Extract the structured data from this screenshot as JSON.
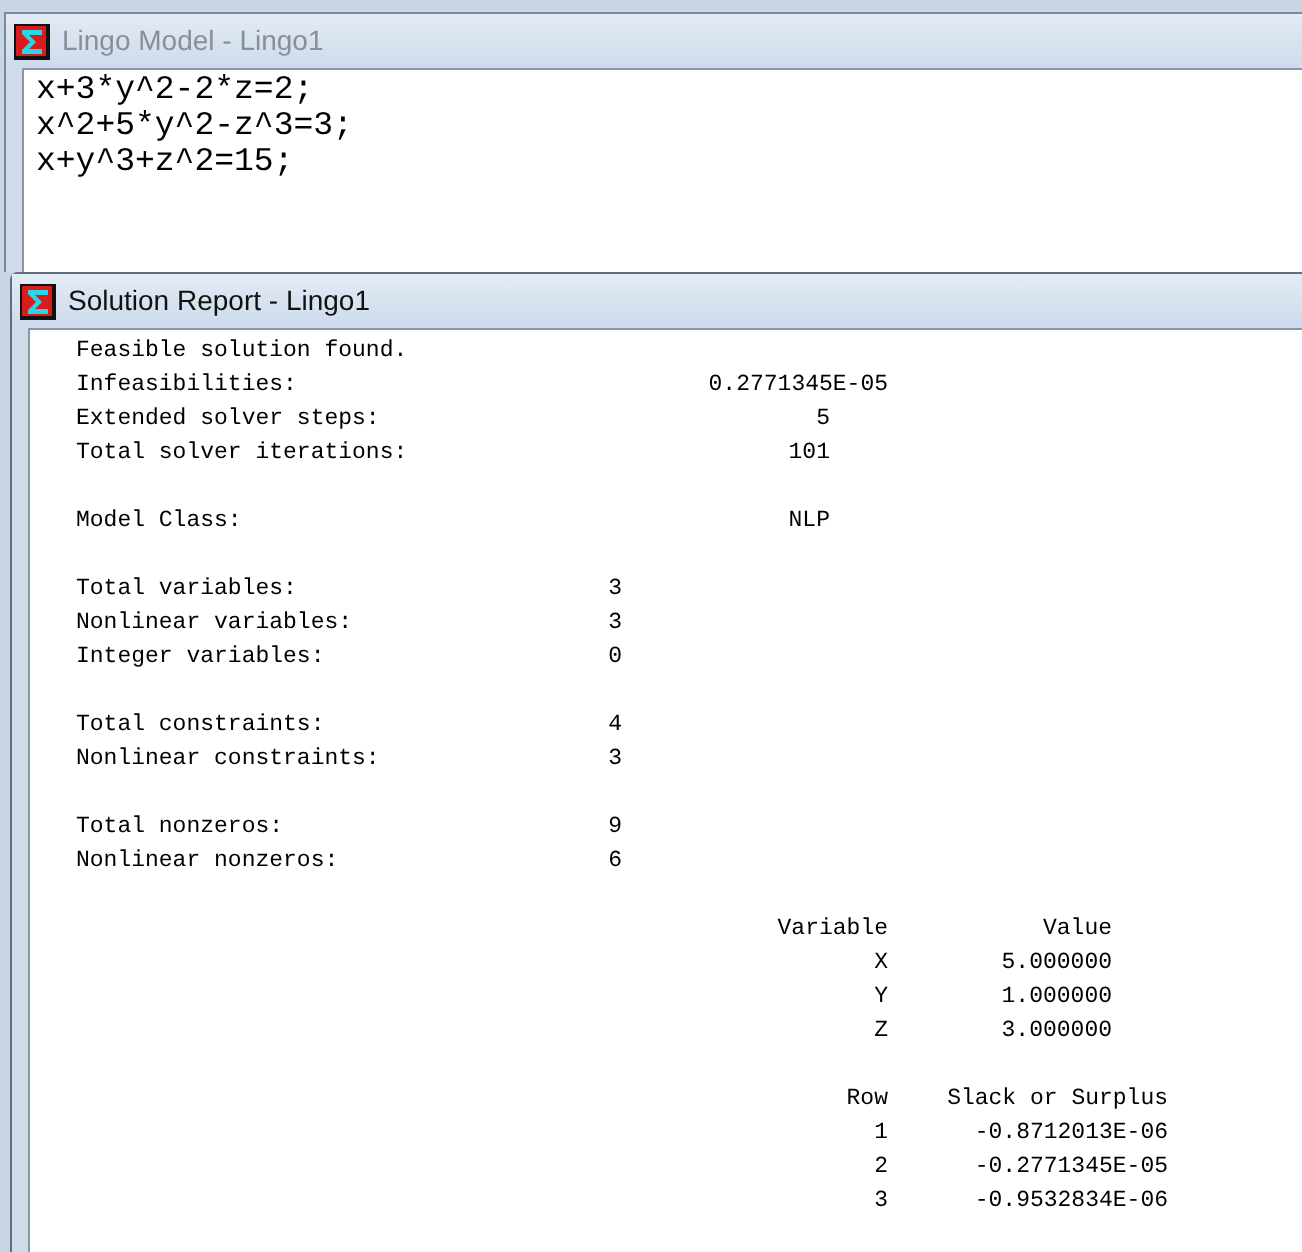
{
  "model_window": {
    "title": "Lingo Model - Lingo1",
    "active": false,
    "lines": [
      "x+3*y^2-2*z=2;",
      "x^2+5*y^2-z^3=3;",
      "x+y^3+z^2=15;"
    ]
  },
  "report_window": {
    "title": "Solution Report - Lingo1",
    "active": true,
    "status": "Feasible solution found.",
    "sections": [
      {
        "items": [
          {
            "label": "Infeasibilities:",
            "value": "0.2771345E-05",
            "kind": "wide"
          },
          {
            "label": "Extended solver steps:",
            "value": "5",
            "kind": "solver"
          },
          {
            "label": "Total solver iterations:",
            "value": "101",
            "kind": "solver"
          }
        ]
      },
      {
        "items": [
          {
            "label": "Model Class:",
            "value": "NLP",
            "kind": "solver"
          }
        ]
      },
      {
        "items": [
          {
            "label": "Total variables:",
            "value": "3",
            "kind": "count"
          },
          {
            "label": "Nonlinear variables:",
            "value": "3",
            "kind": "count"
          },
          {
            "label": "Integer variables:",
            "value": "0",
            "kind": "count"
          }
        ]
      },
      {
        "items": [
          {
            "label": "Total constraints:",
            "value": "4",
            "kind": "count"
          },
          {
            "label": "Nonlinear constraints:",
            "value": "3",
            "kind": "count"
          }
        ]
      },
      {
        "items": [
          {
            "label": "Total nonzeros:",
            "value": "9",
            "kind": "count"
          },
          {
            "label": "Nonlinear nonzeros:",
            "value": "6",
            "kind": "count"
          }
        ]
      }
    ],
    "tables": [
      {
        "kind": "variables",
        "headers": [
          "Variable",
          "Value"
        ],
        "rows": [
          [
            "X",
            "5.000000"
          ],
          [
            "Y",
            "1.000000"
          ],
          [
            "Z",
            "3.000000"
          ]
        ]
      },
      {
        "kind": "slack",
        "headers": [
          "Row",
          "Slack or Surplus"
        ],
        "rows": [
          [
            "1",
            "-0.8712013E-06"
          ],
          [
            "2",
            "-0.2771345E-05"
          ],
          [
            "3",
            "-0.9532834E-06"
          ]
        ]
      }
    ]
  }
}
